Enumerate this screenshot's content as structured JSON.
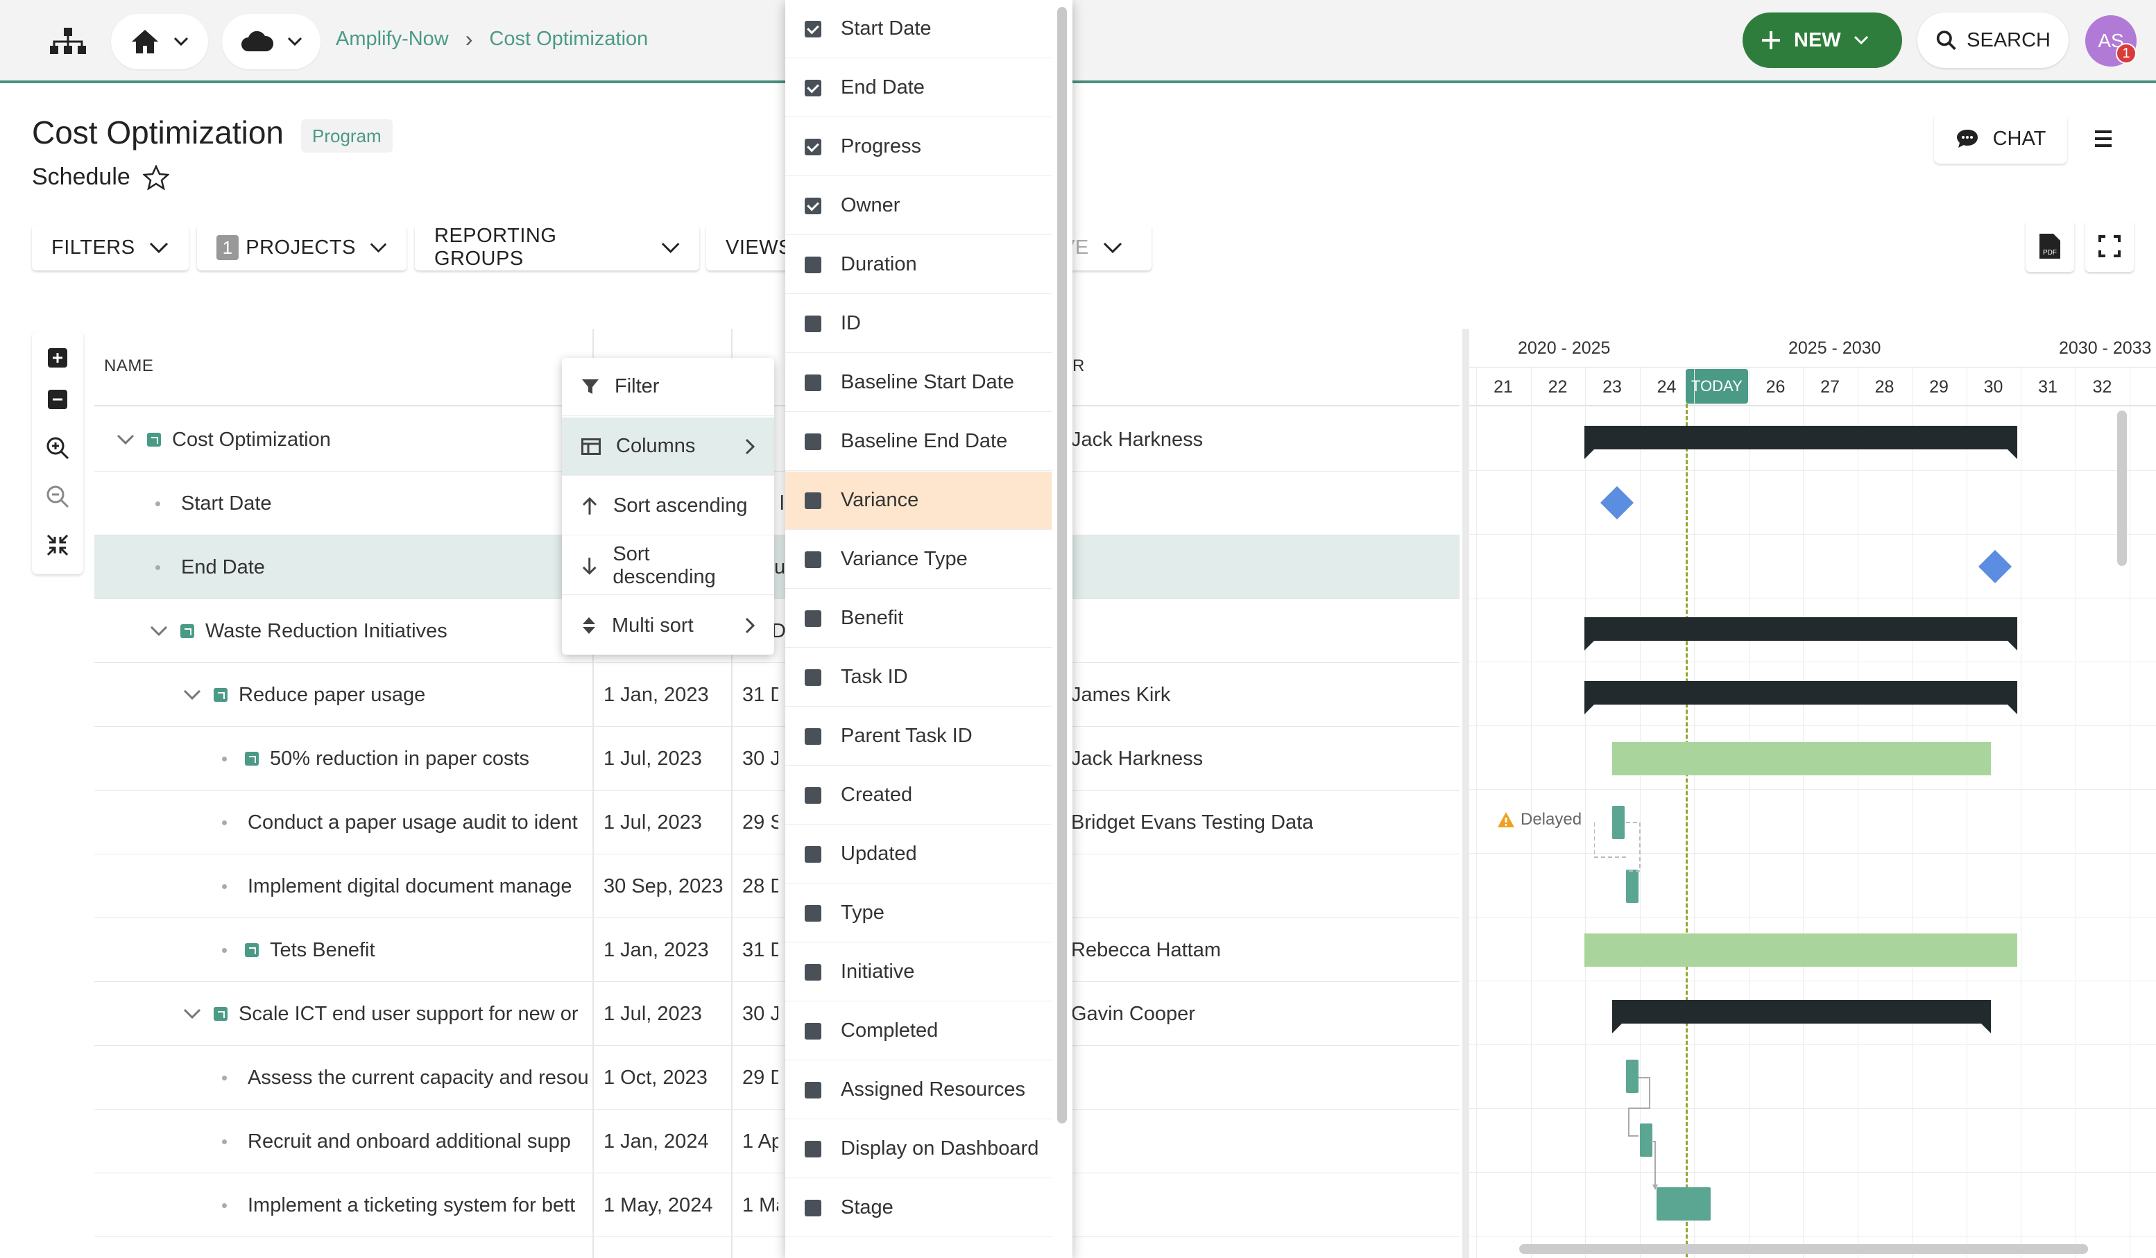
{
  "topbar": {
    "breadcrumb": [
      "Amplify-Now",
      "Cost Optimization"
    ],
    "new_label": "NEW",
    "search_label": "SEARCH",
    "avatar_initials": "AS",
    "avatar_badge": "1"
  },
  "page": {
    "title": "Cost Optimization",
    "type_badge": "Program",
    "subtitle": "Schedule",
    "chat_label": "CHAT"
  },
  "toolbar": {
    "filters": "FILTERS",
    "projects_count": "1",
    "projects": "PROJECTS",
    "reporting_groups": "REPORTING GROUPS",
    "views": "VIEWS",
    "partial": "VE"
  },
  "grid": {
    "name_header": "NAME",
    "owner_header_partial": "R",
    "rows": [
      {
        "name": "Cost Optimization",
        "start": "",
        "end": "",
        "owner": "Jack Harkness"
      },
      {
        "name": "Start Date",
        "start": "",
        "end": "l,",
        "owner": ""
      },
      {
        "name": "End Date",
        "start": "",
        "end": "u",
        "owner": ""
      },
      {
        "name": "Waste Reduction Initiatives",
        "start": "",
        "end": "D",
        "owner": ""
      },
      {
        "name": "Reduce paper usage",
        "start": "1 Jan, 2023",
        "end": "31 D",
        "owner": "James Kirk"
      },
      {
        "name": "50% reduction in paper costs",
        "start": "1 Jul, 2023",
        "end": "30 Ju",
        "owner": "Jack Harkness"
      },
      {
        "name": "Conduct a paper usage audit to ident",
        "start": "1 Jul, 2023",
        "end": "29 Se",
        "owner": "Bridget Evans Testing Data"
      },
      {
        "name": "Implement digital document manage",
        "start": "30 Sep, 2023",
        "end": "28 D",
        "owner": ""
      },
      {
        "name": "Tets Benefit",
        "start": "1 Jan, 2023",
        "end": "31 D",
        "owner": "Rebecca Hattam"
      },
      {
        "name": "Scale ICT end user support for new or",
        "start": "1 Jul, 2023",
        "end": "30 Ju",
        "owner": "Gavin Cooper"
      },
      {
        "name": "Assess the current capacity and resou",
        "start": "1 Oct, 2023",
        "end": "29 D",
        "owner": ""
      },
      {
        "name": "Recruit and onboard additional supp",
        "start": "1 Jan, 2024",
        "end": "1 Apr",
        "owner": ""
      },
      {
        "name": "Implement a ticketing system for bett",
        "start": "1 May, 2024",
        "end": "1 Ma",
        "owner": ""
      }
    ]
  },
  "gantt": {
    "periods": [
      "2020 - 2025",
      "2025 - 2030",
      "2030 - 2033"
    ],
    "days": [
      "21",
      "22",
      "23",
      "24",
      "25",
      "26",
      "27",
      "28",
      "29",
      "30",
      "31",
      "32"
    ],
    "today_label": "TODAY",
    "delayed_label": "Delayed"
  },
  "context_menu": {
    "items": [
      "Filter",
      "Columns",
      "Sort ascending",
      "Sort descending",
      "Multi sort"
    ]
  },
  "columns_menu": {
    "items": [
      {
        "label": "Start Date",
        "checked": true
      },
      {
        "label": "End Date",
        "checked": true
      },
      {
        "label": "Progress",
        "checked": true
      },
      {
        "label": "Owner",
        "checked": true
      },
      {
        "label": "Duration",
        "checked": false
      },
      {
        "label": "ID",
        "checked": false
      },
      {
        "label": "Baseline Start Date",
        "checked": false
      },
      {
        "label": "Baseline End Date",
        "checked": false
      },
      {
        "label": "Variance",
        "checked": false
      },
      {
        "label": "Variance Type",
        "checked": false
      },
      {
        "label": "Benefit",
        "checked": false
      },
      {
        "label": "Task ID",
        "checked": false
      },
      {
        "label": "Parent Task ID",
        "checked": false
      },
      {
        "label": "Created",
        "checked": false
      },
      {
        "label": "Updated",
        "checked": false
      },
      {
        "label": "Type",
        "checked": false
      },
      {
        "label": "Initiative",
        "checked": false
      },
      {
        "label": "Completed",
        "checked": false
      },
      {
        "label": "Assigned Resources",
        "checked": false
      },
      {
        "label": "Display on Dashboard",
        "checked": false
      },
      {
        "label": "Stage",
        "checked": false
      }
    ]
  },
  "colors": {
    "brand": "#4a9a86",
    "new_button": "#2f7d3c",
    "summary_bar": "#232a2e",
    "task_bar": "#a9d59c",
    "milestone": "#5b8de0",
    "highlight_row": "#e2ecea",
    "selected_column": "#fde6cd"
  }
}
